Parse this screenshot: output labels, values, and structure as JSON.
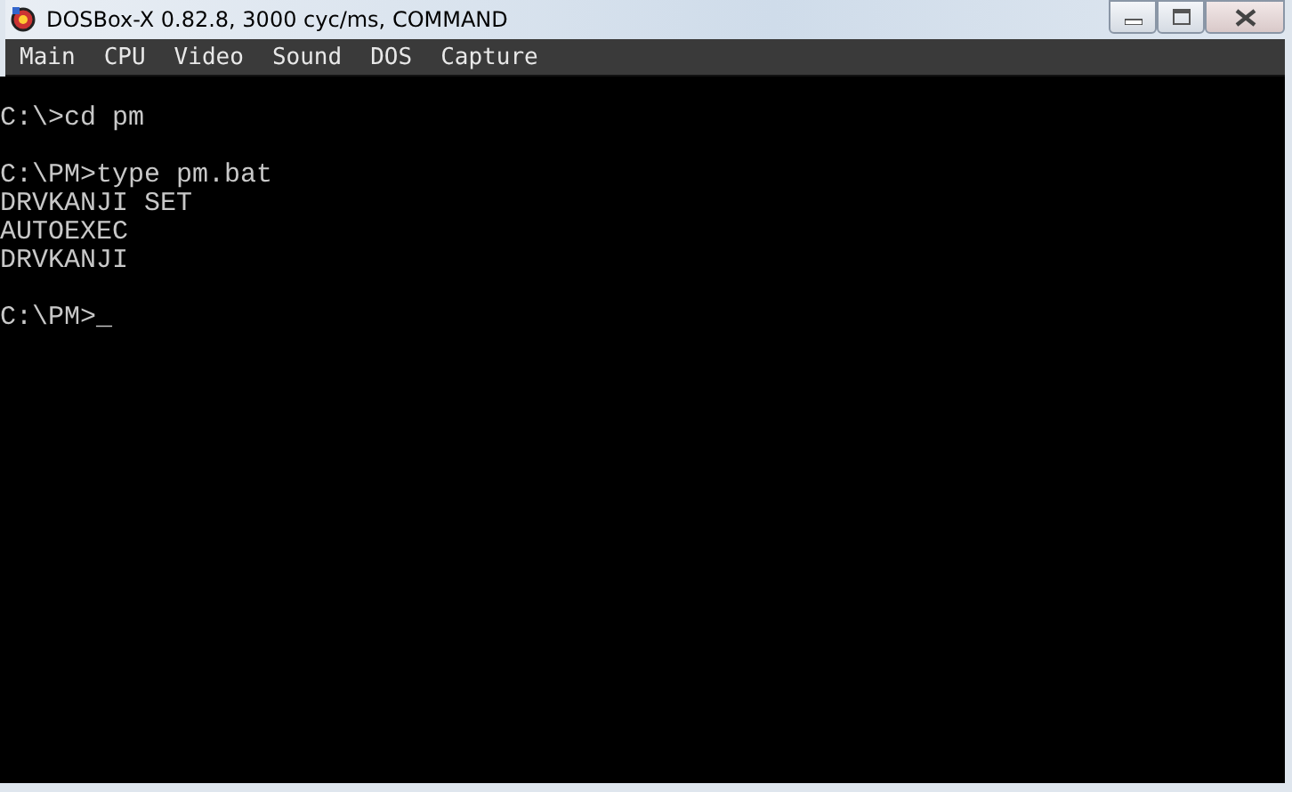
{
  "window": {
    "title": "DOSBox-X 0.82.8, 3000 cyc/ms, COMMAND"
  },
  "menu": [
    "Main",
    "CPU",
    "Video",
    "Sound",
    "DOS",
    "Capture"
  ],
  "console": {
    "blocks": [
      [
        "C:\\>cd pm"
      ],
      [
        "C:\\PM>type pm.bat",
        "DRVKANJI SET",
        "AUTOEXEC",
        "DRVKANJI"
      ],
      [
        "C:\\PM>_"
      ]
    ]
  }
}
